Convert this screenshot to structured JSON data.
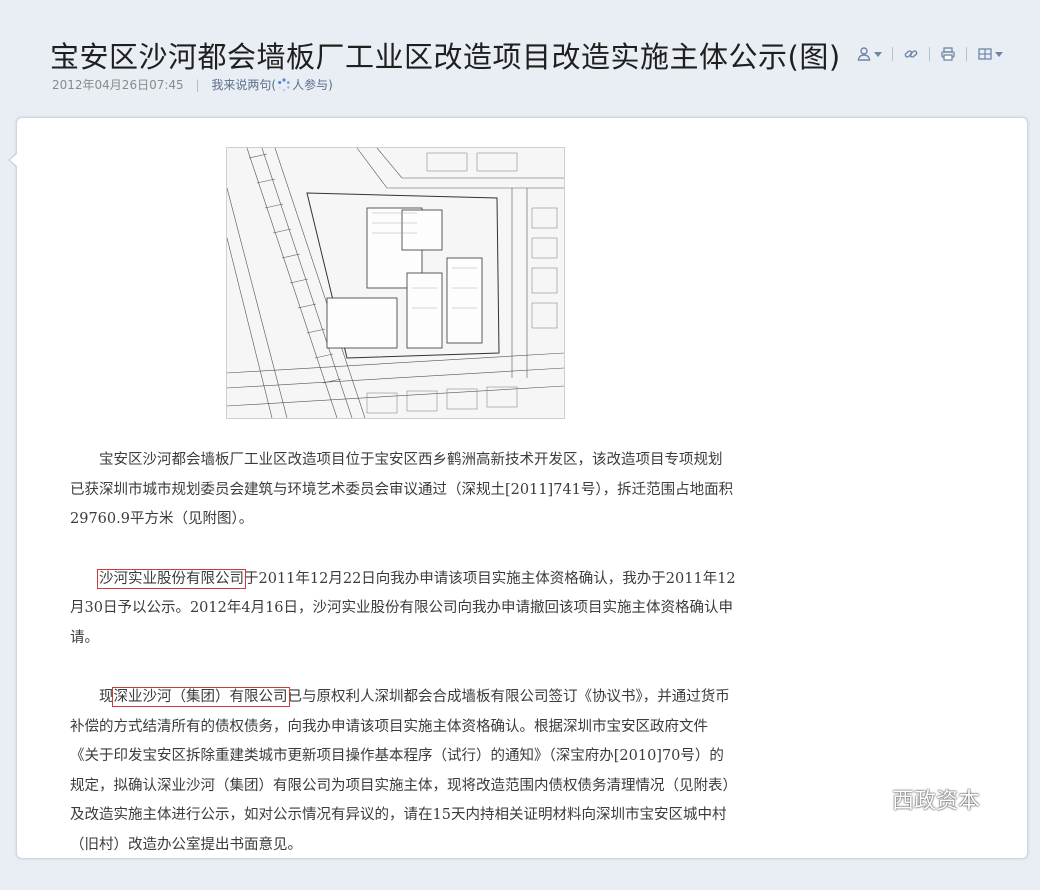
{
  "header": {
    "title": "宝安区沙河都会墙板厂工业区改造项目改造实施主体公示(图)",
    "date": "2012年04月26日07:45",
    "comment_link": "我来说两句",
    "comment_paren_open": "(",
    "participants_label": "人参与)"
  },
  "toolbar": {
    "icons": [
      "user-icon",
      "link-icon",
      "print-icon",
      "grid-icon"
    ]
  },
  "article": {
    "image": "site-plan-map",
    "paragraphs": [
      {
        "prefix": "",
        "highlight": "",
        "text": "宝安区沙河都会墙板厂工业区改造项目位于宝安区西乡鹤洲高新技术开发区，该改造项目专项规划已获深圳市城市规划委员会建筑与环境艺术委员会审议通过（深规土[2011]741号），拆迁范围占地面积29760.9平方米（见附图）。"
      },
      {
        "prefix": "",
        "highlight": "沙河实业股份有限公司",
        "text": "于2011年12月22日向我办申请该项目实施主体资格确认，我办于2011年12月30日予以公示。2012年4月16日，沙河实业股份有限公司向我办申请撤回该项目实施主体资格确认申请。"
      },
      {
        "prefix": "现",
        "highlight": "深业沙河（集团）有限公司",
        "text": "已与原权利人深圳都会合成墙板有限公司签订《协议书》，并通过货币补偿的方式结清所有的债权债务，向我办申请该项目实施主体资格确认。根据深圳市宝安区政府文件《关于印发宝安区拆除重建类城市更新项目操作基本程序（试行）的通知》（深宝府办[2010]70号）的规定，拟确认深业沙河（集团）有限公司为项目实施主体，现将改造范围内债权债务清理情况（见附表）及改造实施主体进行公示，如对公示情况有异议的，请在15天内持相关证明材料向深圳市宝安区城中村（旧村）改造办公室提出书面意见。"
      }
    ]
  },
  "watermark": {
    "text": "西政资本"
  }
}
